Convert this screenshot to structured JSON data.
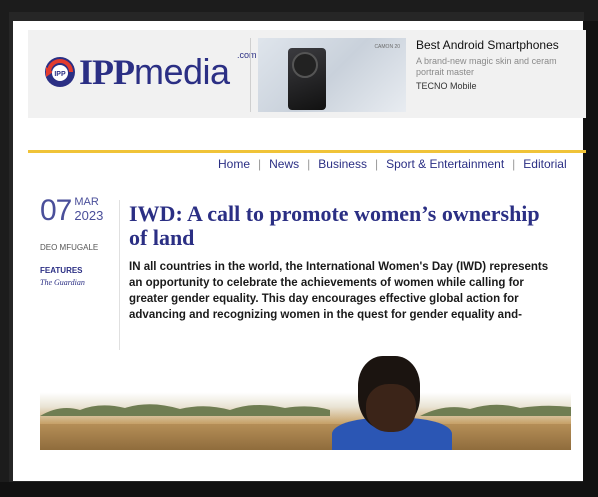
{
  "header": {
    "logo": {
      "brand_bold": "IPP",
      "brand_light": "media",
      "tld": ".com"
    },
    "ad": {
      "image_tag": "CAMON 20",
      "title": "Best Android Smartphones",
      "description": "A brand-new magic skin and ceram portrait master",
      "brand": "TECNO Mobile"
    }
  },
  "nav": {
    "items": [
      "Home",
      "News",
      "Business",
      "Sport & Entertainment",
      "Editorial"
    ]
  },
  "article": {
    "date": {
      "day": "07",
      "month": "MAR",
      "year": "2023"
    },
    "author": "DEO MFUGALE",
    "section": "FEATURES",
    "source": "The Guardian",
    "title": "IWD: A call to promote women’s ownership of land",
    "summary": "IN all countries in the world, the International Women's Day (IWD) represents an opportunity to celebrate the achievements of women while calling for greater gender equality. This day encourages effective global action for advancing and recognizing women in the quest for gender equality and-"
  },
  "colors": {
    "brand": "#2b2f84",
    "accent_line": "#f0c338",
    "logo_red": "#e23b2e"
  },
  "icons": [
    "ipp-logo-icon"
  ]
}
